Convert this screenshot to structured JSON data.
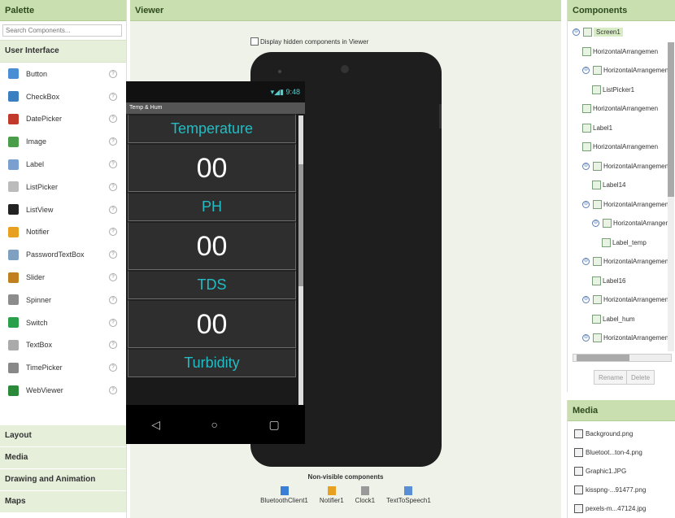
{
  "palette": {
    "title": "Palette",
    "search_placeholder": "Search Components...",
    "category": "User Interface",
    "items": [
      {
        "label": "Button",
        "icon": "button-icon",
        "color": "#4a8fd4"
      },
      {
        "label": "CheckBox",
        "icon": "checkbox-icon",
        "color": "#3c7fc0"
      },
      {
        "label": "DatePicker",
        "icon": "datepicker-icon",
        "color": "#c0392b"
      },
      {
        "label": "Image",
        "icon": "image-icon",
        "color": "#4a9e4a"
      },
      {
        "label": "Label",
        "icon": "label-icon",
        "color": "#7aa0d0"
      },
      {
        "label": "ListPicker",
        "icon": "listpicker-icon",
        "color": "#bbbbbb"
      },
      {
        "label": "ListView",
        "icon": "listview-icon",
        "color": "#222222"
      },
      {
        "label": "Notifier",
        "icon": "notifier-icon",
        "color": "#e8a020"
      },
      {
        "label": "PasswordTextBox",
        "icon": "passwordtextbox-icon",
        "color": "#7fa0c0"
      },
      {
        "label": "Slider",
        "icon": "slider-icon",
        "color": "#c08020"
      },
      {
        "label": "Spinner",
        "icon": "spinner-icon",
        "color": "#8c8c8c"
      },
      {
        "label": "Switch",
        "icon": "switch-icon",
        "color": "#2aa04a"
      },
      {
        "label": "TextBox",
        "icon": "textbox-icon",
        "color": "#aaaaaa"
      },
      {
        "label": "TimePicker",
        "icon": "timepicker-icon",
        "color": "#888888"
      },
      {
        "label": "WebViewer",
        "icon": "webviewer-icon",
        "color": "#2a8a3a"
      }
    ],
    "help_glyph": "?",
    "bottom_categories": [
      "Layout",
      "Media",
      "Drawing and Animation",
      "Maps"
    ]
  },
  "viewer": {
    "title": "Viewer",
    "hidden_label": "Display hidden components in Viewer",
    "status_time": "9:48",
    "app_title": "Temp & Hum",
    "sections": [
      {
        "kind": "small",
        "text": "Temperature"
      },
      {
        "kind": "big",
        "text": "00"
      },
      {
        "kind": "small",
        "text": "PH"
      },
      {
        "kind": "big",
        "text": "00"
      },
      {
        "kind": "small",
        "text": "TDS"
      },
      {
        "kind": "big",
        "text": "00"
      },
      {
        "kind": "small",
        "text": "Turbidity"
      }
    ],
    "nav": {
      "back": "◁",
      "home": "○",
      "recent": "▢"
    },
    "nonvisible_title": "Non-visible components",
    "nonvisible": [
      {
        "label": "BluetoothClient1",
        "icon": "bluetooth-icon",
        "color": "#3a7fd5"
      },
      {
        "label": "Notifier1",
        "icon": "notifier-icon",
        "color": "#e8a020"
      },
      {
        "label": "Clock1",
        "icon": "clock-icon",
        "color": "#999999"
      },
      {
        "label": "TextToSpeech1",
        "icon": "speech-icon",
        "color": "#5a8fd5"
      }
    ]
  },
  "components": {
    "title": "Components",
    "tree": [
      {
        "label": "Screen1",
        "level": 0,
        "toggle": "⊖"
      },
      {
        "label": "HorizontalArrangemen",
        "level": 1,
        "toggle": ""
      },
      {
        "label": "HorizontalArrangemen",
        "level": 1,
        "toggle": "⊖"
      },
      {
        "label": "ListPicker1",
        "level": 2,
        "toggle": ""
      },
      {
        "label": "HorizontalArrangemen",
        "level": 1,
        "toggle": ""
      },
      {
        "label": "Label1",
        "level": 1,
        "toggle": ""
      },
      {
        "label": "HorizontalArrangemen",
        "level": 1,
        "toggle": ""
      },
      {
        "label": "HorizontalArrangemen",
        "level": 1,
        "toggle": "⊖"
      },
      {
        "label": "Label14",
        "level": 2,
        "toggle": ""
      },
      {
        "label": "HorizontalArrangemen",
        "level": 1,
        "toggle": "⊖"
      },
      {
        "label": "HorizontalArrangen",
        "level": 2,
        "toggle": "⊖"
      },
      {
        "label": "Label_temp",
        "level": 3,
        "toggle": ""
      },
      {
        "label": "HorizontalArrangemen",
        "level": 1,
        "toggle": "⊖"
      },
      {
        "label": "Label16",
        "level": 2,
        "toggle": ""
      },
      {
        "label": "HorizontalArrangemen",
        "level": 1,
        "toggle": "⊖"
      },
      {
        "label": "Label_hum",
        "level": 2,
        "toggle": ""
      },
      {
        "label": "HorizontalArrangemen",
        "level": 1,
        "toggle": "⊖"
      }
    ],
    "rename_label": "Rename",
    "delete_label": "Delete"
  },
  "media": {
    "title": "Media",
    "files": [
      "Background.png",
      "Bluetoot...ton-4.png",
      "Graphic1.JPG",
      "kisspng-...91477.png",
      "pexels-m...47124.jpg"
    ]
  }
}
